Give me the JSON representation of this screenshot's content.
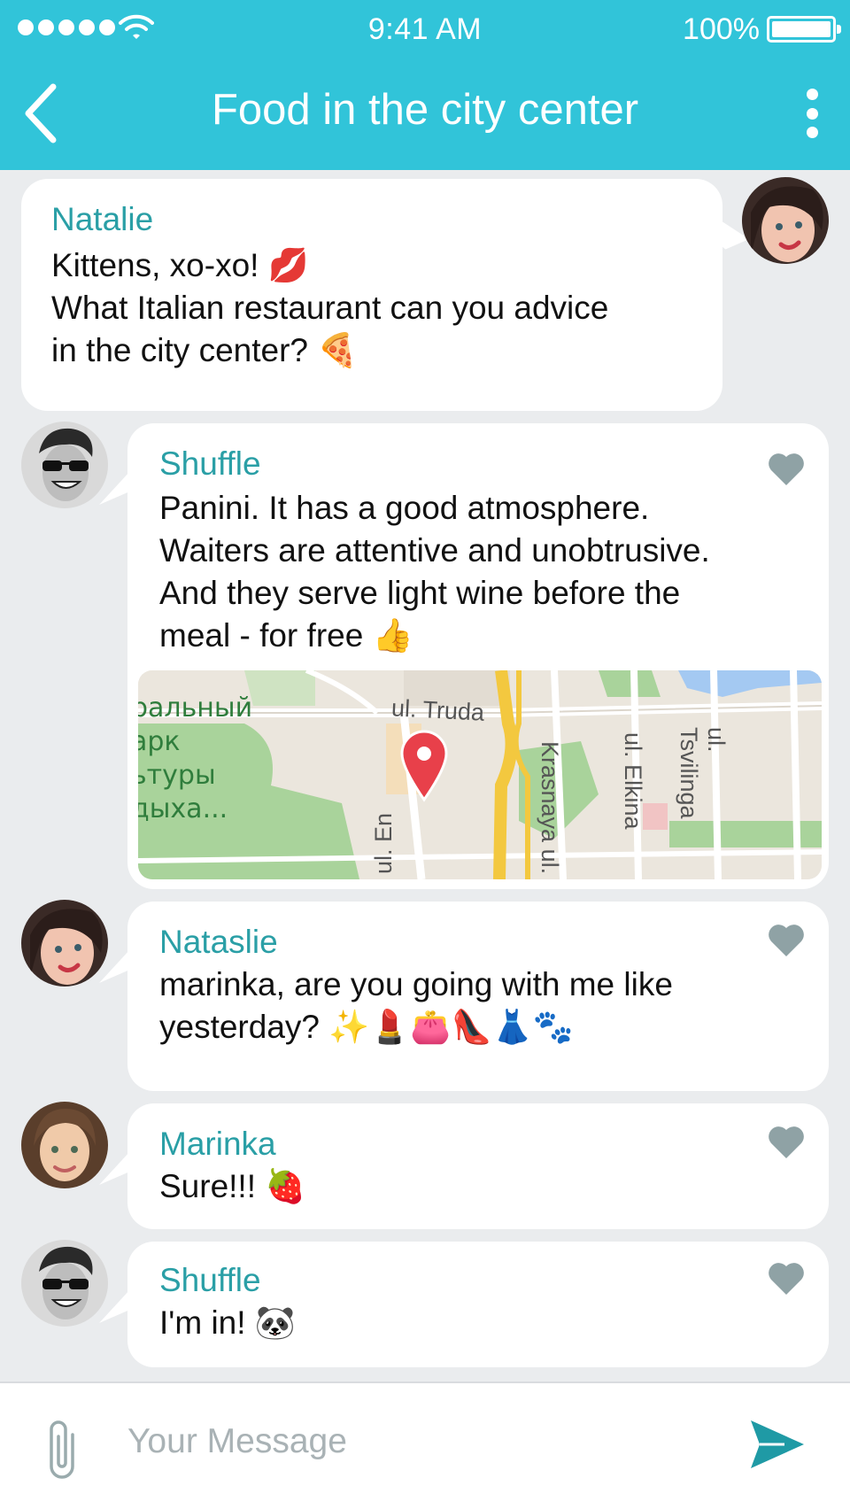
{
  "status_bar": {
    "time": "9:41 AM",
    "battery": "100%"
  },
  "header": {
    "title": "Food in the city center"
  },
  "messages": [
    {
      "sender": "Natalie",
      "text": "Kittens, xo-xo! 💋\nWhat Italian restaurant can you advice\nin the city center? 🍕"
    },
    {
      "sender": "Shuffle",
      "text": "Panini. It has a good atmosphere.\nWaiters are attentive and unobtrusive.\nAnd they serve light wine before the\nmeal - for free 👍"
    },
    {
      "sender": "Nataslie",
      "text": "marinka, are you going with me like\nyesterday? ✨💄👛👠👗🐾"
    },
    {
      "sender": "Marinka",
      "text": "Sure!!! 🍓"
    },
    {
      "sender": "Shuffle",
      "text": "I'm in!  🐼"
    }
  ],
  "map": {
    "park_lines": [
      "ральный",
      "арк",
      "ьтуры",
      "дыха..."
    ],
    "streets": {
      "truda": "ul. Truda",
      "en": "ul. En",
      "krasnaya": "Krasnaya ul.",
      "elkina": "ul. Elkina",
      "tsvilinga": "ul. Tsvilinga"
    }
  },
  "input": {
    "placeholder": "Your Message"
  },
  "icons": {
    "back": "chevron-left-icon",
    "more": "more-vertical-icon",
    "heart": "heart-icon",
    "attach": "paperclip-icon",
    "send": "send-icon",
    "pin": "map-pin-icon"
  },
  "colors": {
    "accent": "#31c4d9",
    "sender_name": "#2a9fa6",
    "heart": "#8fa2a5",
    "background": "#eaecee"
  }
}
